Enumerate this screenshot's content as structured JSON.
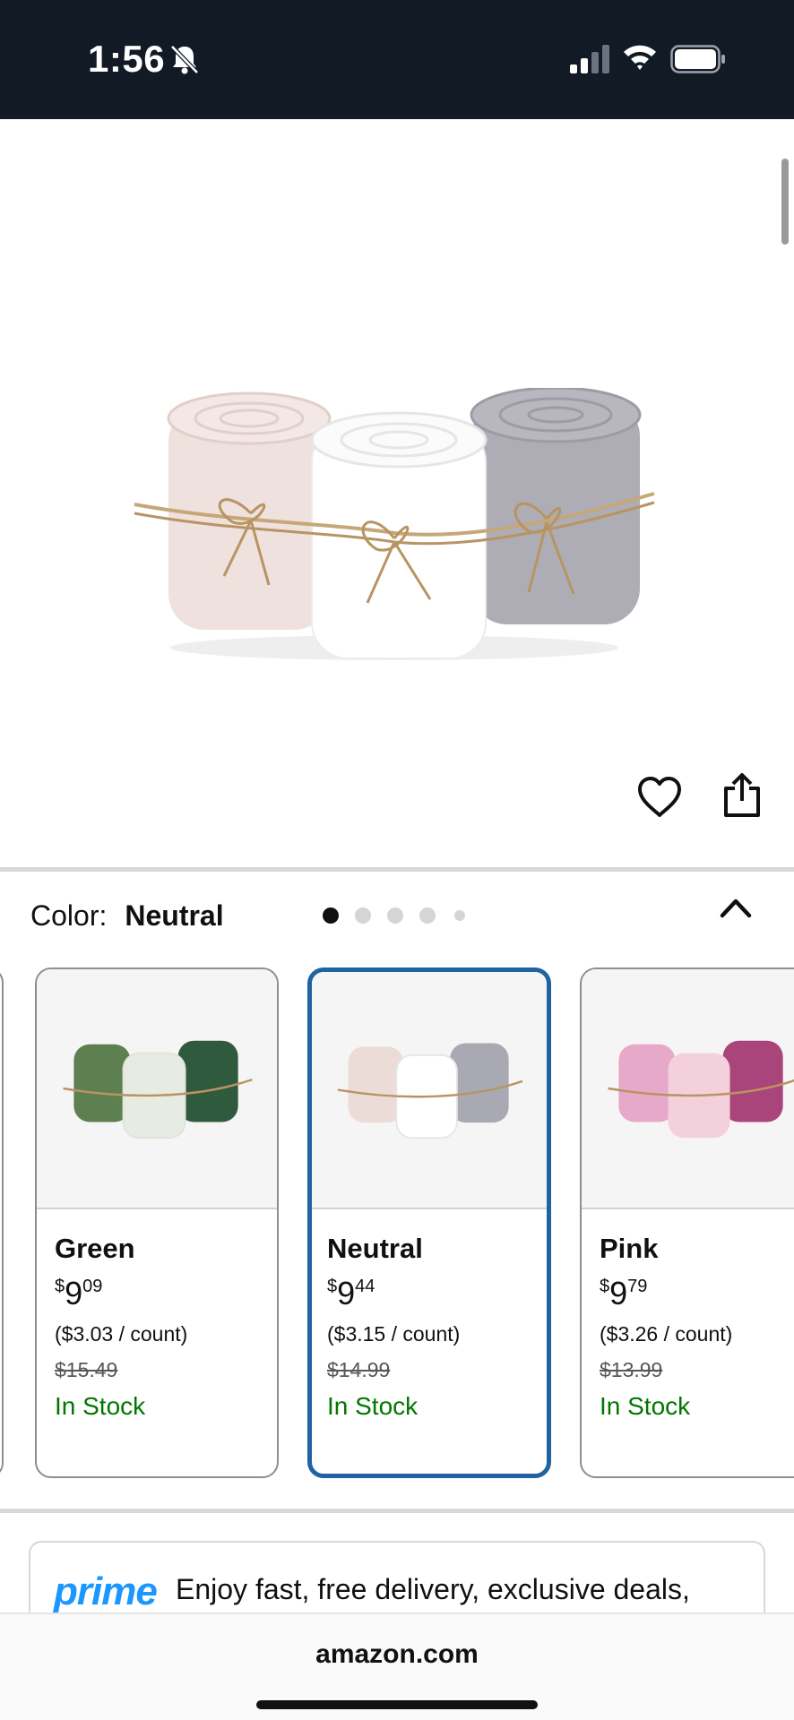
{
  "status_bar": {
    "time": "1:56",
    "icons": [
      "bell-slash-icon",
      "signal-icon",
      "wifi-icon",
      "battery-icon"
    ]
  },
  "gallery": {
    "image": "baby-blankets-neutral-rolls",
    "page_count": 5,
    "active_page": 1
  },
  "color_selector": {
    "label": "Color:",
    "selected": "Neutral",
    "options": [
      {
        "name": "Green",
        "price_currency": "$",
        "price_whole": "9",
        "price_cents": "09",
        "unit_price": "($3.03 / count)",
        "list_price": "$15.49",
        "availability": "In Stock",
        "colors": [
          "#5e7f4f",
          "#e6ece1",
          "#2f5a3d"
        ]
      },
      {
        "name": "Neutral",
        "price_currency": "$",
        "price_whole": "9",
        "price_cents": "44",
        "unit_price": "($3.15 / count)",
        "list_price": "$14.99",
        "availability": "In Stock",
        "colors": [
          "#ecdcd8",
          "#ffffff",
          "#a9a9b3"
        ]
      },
      {
        "name": "Pink",
        "price_currency": "$",
        "price_whole": "9",
        "price_cents": "79",
        "unit_price": "($3.26 / count)",
        "list_price": "$13.99",
        "availability": "In Stock",
        "colors": [
          "#e7a9c9",
          "#f4d0dc",
          "#a9457a"
        ]
      }
    ]
  },
  "prime_banner": {
    "logo": "prime",
    "text": "Enjoy fast, free delivery, exclusive deals,"
  },
  "browser": {
    "url": "amazon.com"
  },
  "colors": {
    "status_bar_bg": "#121a26",
    "selected_border": "#2162a1",
    "in_stock": "#007600",
    "prime_blue": "#1a98ff"
  }
}
